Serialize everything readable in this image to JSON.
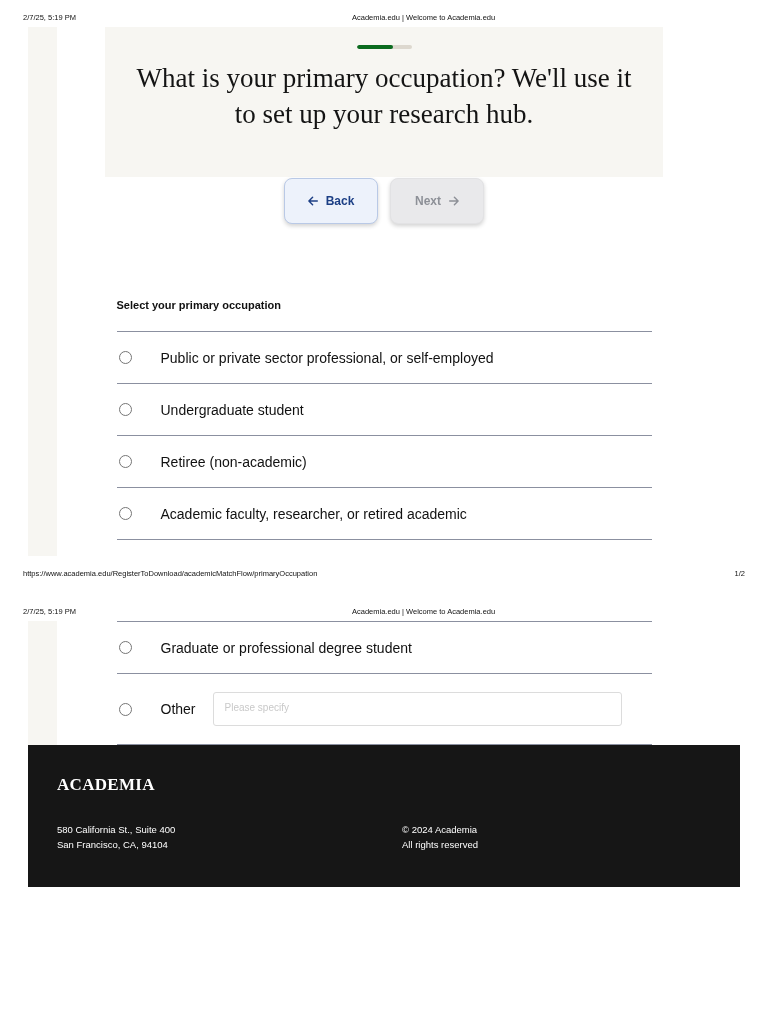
{
  "pages": [
    {
      "print_header": {
        "date": "2/7/25, 5:19 PM",
        "title": "Academia.edu | Welcome to Academia.edu"
      },
      "progress": {
        "level": 0.67
      },
      "question": "What is your primary occupation? We'll use it to set up your research hub.",
      "buttons": [
        {
          "kind": "back",
          "label": "Back",
          "disabled": false
        },
        {
          "kind": "next",
          "label": "Next",
          "disabled": true
        }
      ],
      "occupation_label": "Select your primary occupation",
      "options": [
        {
          "kind": "plain",
          "label": "Public or private sector professional, or self-employed",
          "selected": false
        },
        {
          "kind": "plain",
          "label": "Undergraduate student",
          "selected": false
        },
        {
          "kind": "plain",
          "label": "Retiree (non-academic)",
          "selected": false
        },
        {
          "kind": "plain",
          "label": "Academic faculty, researcher, or retired academic",
          "selected": false
        }
      ],
      "print_footer": {
        "url": "https://www.academia.edu/RegisterToDownload/academicMatchFlow/primaryOccupation",
        "page": "1/2"
      }
    },
    {
      "print_header": {
        "date": "2/7/25, 5:19 PM",
        "title": "Academia.edu | Welcome to Academia.edu"
      },
      "options": [
        {
          "kind": "plain",
          "label": "Graduate or professional degree student",
          "selected": false
        },
        {
          "kind": "other",
          "label": "Other",
          "selected": false,
          "placeholder": "Please specify"
        }
      ],
      "site_footer": {
        "logo": "ACADEMIA",
        "address": [
          "580 California St., Suite 400",
          "San Francisco, CA, 94104"
        ],
        "legal": [
          "© 2024 Academia",
          "All rights reserved"
        ]
      }
    }
  ]
}
